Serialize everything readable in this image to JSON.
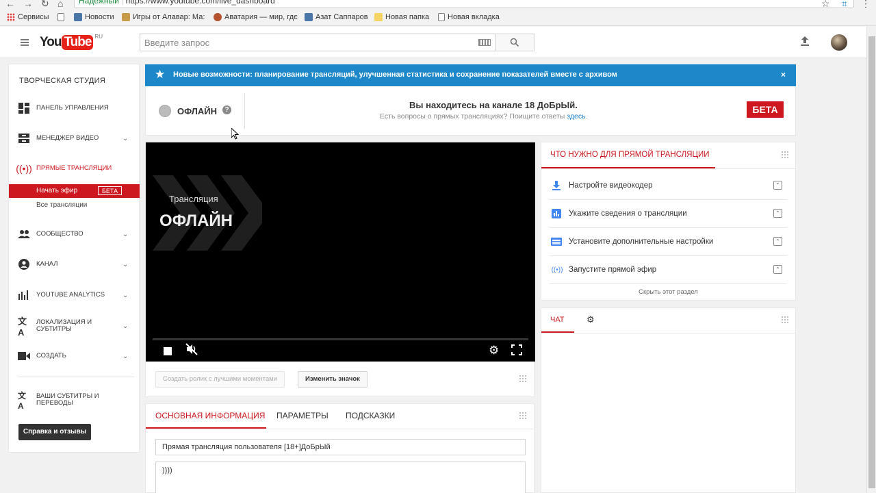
{
  "browser": {
    "secure_label": "Надежный",
    "url": "https://www.youtube.com/live_dashboard",
    "bookmarks": [
      {
        "label": "Сервисы",
        "icon": "apps-grid-icon"
      },
      {
        "label": "",
        "icon": "page-icon"
      },
      {
        "label": "Новости",
        "icon": "vk-icon"
      },
      {
        "label": "Игры от Алавар: Ма:",
        "icon": "game-icon"
      },
      {
        "label": "Аватария — мир, гдє",
        "icon": "avatar-game-icon"
      },
      {
        "label": "Азат Саппаров",
        "icon": "vk-icon"
      },
      {
        "label": "Новая папка",
        "icon": "folder-icon"
      },
      {
        "label": "Новая вкладка",
        "icon": "page-icon"
      }
    ]
  },
  "header": {
    "logo_you": "You",
    "logo_tube": "Tube",
    "logo_region": "RU",
    "search_placeholder": "Введите запрос"
  },
  "sidebar": {
    "title": "ТВОРЧЕСКАЯ СТУДИЯ",
    "items": [
      {
        "label": "ПАНЕЛЬ УПРАВЛЕНИЯ",
        "icon": "dashboard-icon"
      },
      {
        "label": "МЕНЕДЖЕР ВИДЕО",
        "icon": "video-manager-icon"
      },
      {
        "label": "ПРЯМЫЕ ТРАНСЛЯЦИИ",
        "icon": "live-broadcast-icon"
      },
      {
        "label": "СООБЩЕСТВО",
        "icon": "community-icon"
      },
      {
        "label": "КАНАЛ",
        "icon": "channel-icon"
      },
      {
        "label": "YOUTUBE ANALYTICS",
        "icon": "analytics-icon"
      },
      {
        "label": "ЛОКАЛИЗАЦИЯ И СУБТИТРЫ",
        "icon": "translate-icon"
      },
      {
        "label": "СОЗДАТЬ",
        "icon": "create-video-icon"
      }
    ],
    "live_sub": {
      "start": "Начать эфир",
      "start_badge": "БЕТА",
      "all": "Все трансляции"
    },
    "subtitles_item": "ВАШИ СУБТИТРЫ И ПЕРЕВОДЫ",
    "help_button": "Справка и отзывы"
  },
  "banner": {
    "message": "Новые возможности: планирование трансляций, улучшенная статистика и сохранение показателей вместе с архивом",
    "close": "×"
  },
  "status": {
    "state": "ОФЛАЙН",
    "help": "?",
    "channel": "Вы находитесь на канале 18 ДоБрЫй.",
    "faq_text": "Есть вопросы о прямых трансляциях? Поищите ответы ",
    "faq_link": "здесь",
    "faq_end": ".",
    "beta": "БЕТА"
  },
  "player": {
    "small_title": "Трансляция",
    "big_title": "ОФЛАЙН"
  },
  "video_actions": {
    "highlights": "Создать ролик с лучшими моментами",
    "change_thumb": "Изменить значок"
  },
  "checklist": {
    "tab": "ЧТО НУЖНО ДЛЯ ПРЯМОЙ ТРАНСЛЯЦИИ",
    "items": [
      {
        "label": "Настройте видеокодер",
        "icon": "download-icon"
      },
      {
        "label": "Укажите сведения о трансляции",
        "icon": "info-chart-icon"
      },
      {
        "label": "Установите дополнительные настройки",
        "icon": "card-settings-icon"
      },
      {
        "label": "Запустите прямой эфир",
        "icon": "broadcast-icon"
      }
    ],
    "hide": "Скрыть этот раздел"
  },
  "chat": {
    "tab": "ЧАТ"
  },
  "info": {
    "tabs": [
      "ОСНОВНАЯ ИНФОРМАЦИЯ",
      "ПАРАМЕТРЫ",
      "ПОДСКАЗКИ"
    ],
    "title_value": "Прямая трансляция пользователя [18+]ДоБрЫй",
    "description_value": "))))"
  },
  "colors": {
    "accent_red": "#cc181e",
    "banner_blue": "#1c87c9",
    "link_blue": "#167ac6"
  }
}
